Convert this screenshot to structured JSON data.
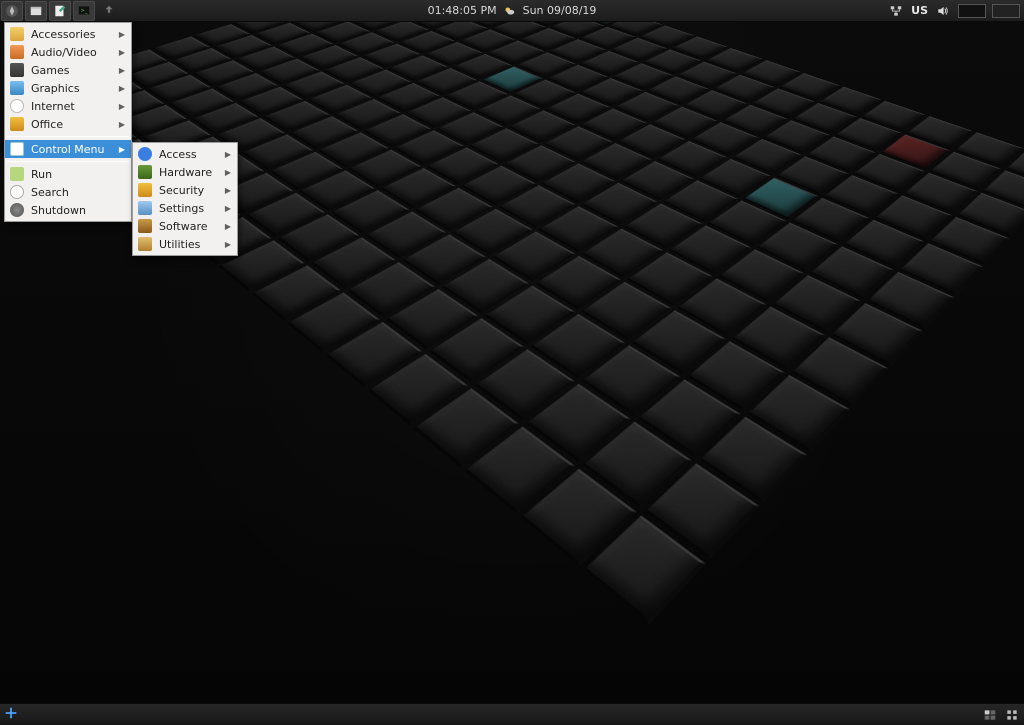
{
  "top_panel": {
    "clock": "01:48:05 PM",
    "date": "Sun 09/08/19",
    "keyboard_layout": "US"
  },
  "menu": {
    "categories": [
      {
        "label": "Accessories",
        "icon": "folder",
        "has_submenu": true
      },
      {
        "label": "Audio/Video",
        "icon": "audio",
        "has_submenu": true
      },
      {
        "label": "Games",
        "icon": "games",
        "has_submenu": true
      },
      {
        "label": "Graphics",
        "icon": "graphics",
        "has_submenu": true
      },
      {
        "label": "Internet",
        "icon": "internet",
        "has_submenu": true
      },
      {
        "label": "Office",
        "icon": "office",
        "has_submenu": true
      }
    ],
    "control_label": "Control Menu",
    "actions": [
      {
        "label": "Run",
        "icon": "run"
      },
      {
        "label": "Search",
        "icon": "search"
      },
      {
        "label": "Shutdown",
        "icon": "shutdown"
      }
    ]
  },
  "submenu": {
    "items": [
      {
        "label": "Access",
        "icon": "access"
      },
      {
        "label": "Hardware",
        "icon": "hardware"
      },
      {
        "label": "Security",
        "icon": "security"
      },
      {
        "label": "Settings",
        "icon": "settings"
      },
      {
        "label": "Software",
        "icon": "software"
      },
      {
        "label": "Utilities",
        "icon": "utilities"
      }
    ]
  }
}
